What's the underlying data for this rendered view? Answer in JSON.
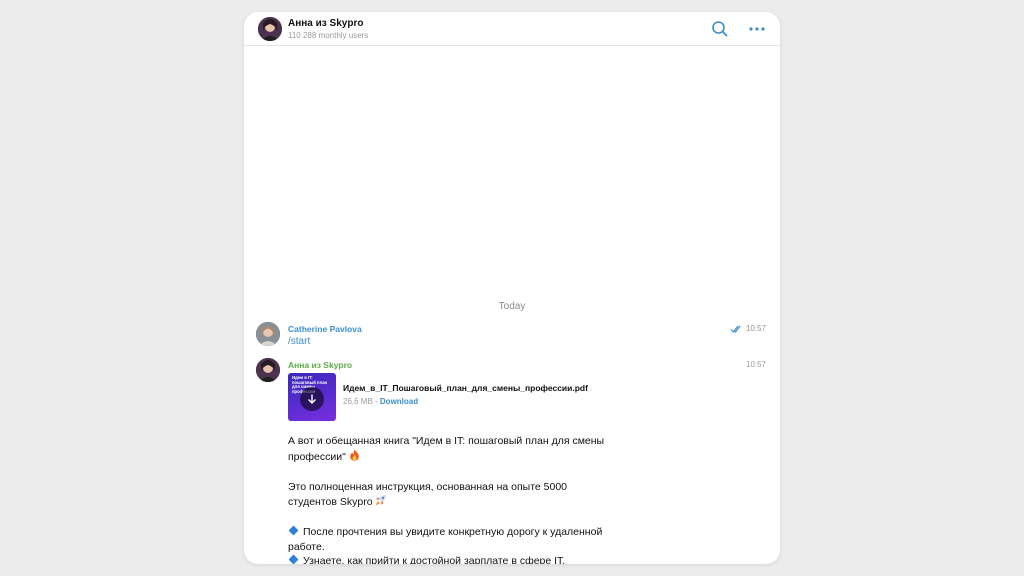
{
  "header": {
    "title": "Анна из Skypro",
    "subtitle": "110 288 monthly users",
    "search_icon": "search-icon",
    "more_icon": "more-horizontal-icon"
  },
  "chat": {
    "date_separator": "Today",
    "messages": [
      {
        "sender": "Catherine Pavlova",
        "sender_color": "#3a8fd0",
        "time": "10:57",
        "read_status_icon": "double-check-icon",
        "text": "/start"
      },
      {
        "sender": "Анна из Skypro",
        "sender_color": "#5fab47",
        "time": "10:57",
        "document": {
          "thumb_text": "Идем в IT: пошаговый план для смены профессии",
          "file_name": "Идем_в_IT_Пошаговый_план_для_смены_профессии.pdf",
          "size": "26,6 MB",
          "separator": " - ",
          "action": "Download"
        },
        "paragraphs": [
          "А вот и обещанная книга \"Идем в IT: пошаговый план для смены профессии\"",
          "Это полноценная инструкция, основанная на опыте 5000 студентов Skypro",
          "После прочтения вы увидите конкретную дорогу к удаленной работе.",
          "Узнаете, как прийти к достойной зарплате в сфере IT."
        ]
      }
    ]
  },
  "colors": {
    "accent": "#3a8fd0",
    "bot_name": "#5fab47",
    "background": "#ececec"
  }
}
